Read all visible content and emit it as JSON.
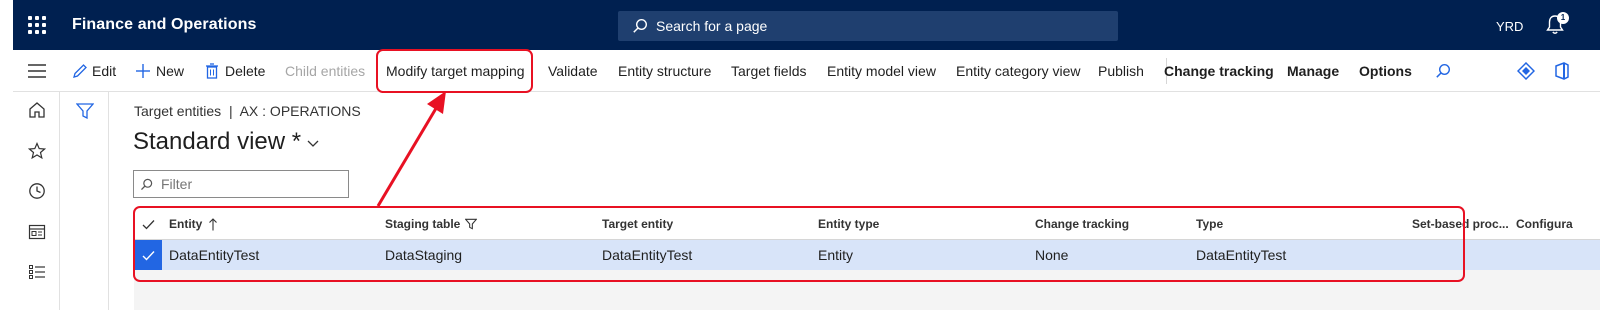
{
  "topbar": {
    "app_title": "Finance and Operations",
    "search_placeholder": "Search for a page",
    "company": "YRD",
    "notification_count": "1"
  },
  "actions": {
    "edit": "Edit",
    "new": "New",
    "delete": "Delete",
    "child_entities": "Child entities",
    "modify_target_mapping": "Modify target mapping",
    "validate": "Validate",
    "entity_structure": "Entity structure",
    "target_fields": "Target fields",
    "entity_model_view": "Entity model view",
    "entity_category_view": "Entity category view",
    "publish": "Publish",
    "change_tracking": "Change tracking",
    "manage": "Manage",
    "options": "Options"
  },
  "page": {
    "breadcrumb": "Target entities  |  AX : OPERATIONS",
    "view_title": "Standard view *",
    "filter_placeholder": "Filter"
  },
  "grid": {
    "columns": [
      "Entity",
      "Staging table",
      "Target entity",
      "Entity type",
      "Change tracking",
      "Type",
      "Set-based proc...",
      "Configura"
    ],
    "rows": [
      [
        "DataEntityTest",
        "DataStaging",
        "DataEntityTest",
        "Entity",
        "None",
        "DataEntityTest",
        "",
        ""
      ]
    ]
  },
  "colors": {
    "topbar": "#002050",
    "accent": "#2266e3",
    "selected_row": "#d8e4f9",
    "annotation": "#e81123"
  }
}
